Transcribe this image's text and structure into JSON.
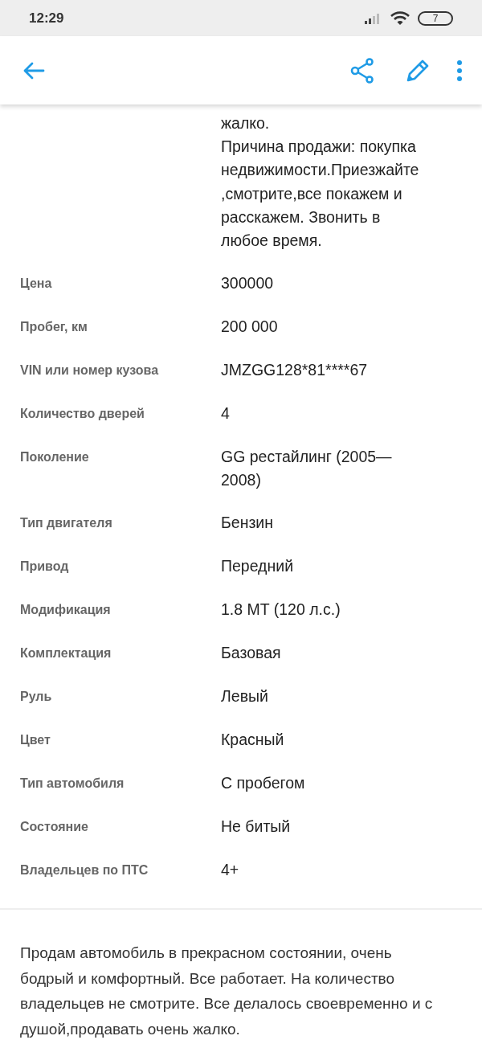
{
  "status_bar": {
    "time": "12:29",
    "battery": "7"
  },
  "description_tail": "жалко.\nПричина продажи: покупка\nнедвижимости.Приезжайте\n,смотрите,все покажем и\nрасскажем. Звонить в\nлюбое время.",
  "params": [
    {
      "label": "Цена",
      "value": "300000"
    },
    {
      "label": "Пробег, км",
      "value": "200 000"
    },
    {
      "label": "VIN или номер кузова",
      "value": "JMZGG128*81****67"
    },
    {
      "label": "Количество дверей",
      "value": "4"
    },
    {
      "label": "Поколение",
      "value": "GG рестайлинг (2005—\n2008)"
    },
    {
      "label": "Тип двигателя",
      "value": "Бензин"
    },
    {
      "label": "Привод",
      "value": "Передний"
    },
    {
      "label": "Модификация",
      "value": "1.8 MT (120 л.с.)"
    },
    {
      "label": "Комплектация",
      "value": "Базовая"
    },
    {
      "label": "Руль",
      "value": "Левый"
    },
    {
      "label": "Цвет",
      "value": "Красный"
    },
    {
      "label": "Тип автомобиля",
      "value": "С пробегом"
    },
    {
      "label": "Состояние",
      "value": "Не битый"
    },
    {
      "label": "Владельцев по ПТС",
      "value": "4+"
    }
  ],
  "description": "Продам автомобиль в прекрасном состоянии, очень бодрый и комфортный. Все работает. На количество владельцев не смотрите. Все делалось своевременно и с душой,продавать очень жалко."
}
